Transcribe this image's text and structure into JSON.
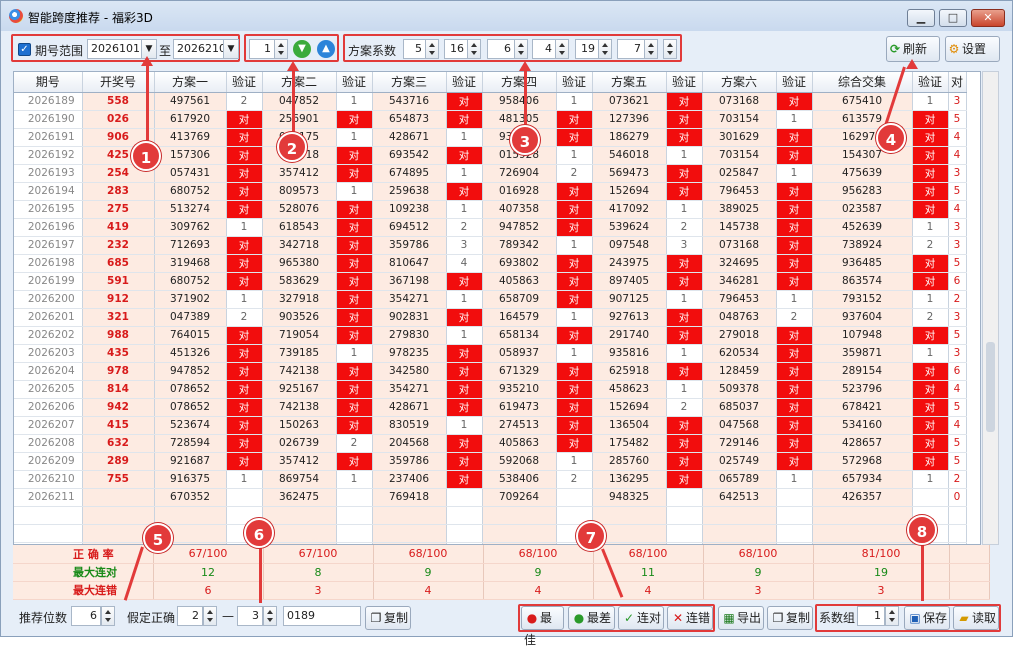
{
  "window": {
    "title": "智能跨度推荐 - 福彩3D",
    "min_label": "▁",
    "max_label": "□",
    "close_label": "✕"
  },
  "toolbar": {
    "period_range_label": "期号范围",
    "period_from": "2026101",
    "period_to": "2026210",
    "to_label": "至",
    "step_value": "1",
    "scheme_coef_label": "方案系数",
    "coef_values": [
      "5",
      "16",
      "6",
      "4",
      "19",
      "7"
    ],
    "refresh_label": "刷新",
    "settings_label": "设置"
  },
  "grid": {
    "headers": [
      "期号",
      "开奖号",
      "方案一",
      "验证",
      "方案二",
      "验证",
      "方案三",
      "验证",
      "方案四",
      "验证",
      "方案五",
      "验证",
      "方案六",
      "验证",
      "综合交集",
      "验证",
      "对"
    ],
    "rows": [
      [
        "2026189",
        "558",
        "497561",
        "2",
        "047852",
        "1",
        "543716",
        "对",
        "958406",
        "1",
        "073621",
        "对",
        "073168",
        "对",
        "675410",
        "1",
        "3"
      ],
      [
        "2026190",
        "026",
        "617920",
        "对",
        "256901",
        "对",
        "654873",
        "对",
        "481305",
        "对",
        "127396",
        "对",
        "703154",
        "1",
        "613579",
        "对",
        "5"
      ],
      [
        "2026191",
        "906",
        "413769",
        "对",
        "086175",
        "1",
        "428671",
        "1",
        "935016",
        "对",
        "186279",
        "对",
        "301629",
        "对",
        "162978",
        "对",
        "4"
      ],
      [
        "2026192",
        "425",
        "157306",
        "对",
        "023718",
        "对",
        "693542",
        "对",
        "015928",
        "1",
        "546018",
        "1",
        "703154",
        "对",
        "154307",
        "对",
        "4"
      ],
      [
        "2026193",
        "254",
        "057431",
        "对",
        "357412",
        "对",
        "674895",
        "1",
        "726904",
        "2",
        "569473",
        "对",
        "025847",
        "1",
        "475639",
        "对",
        "3"
      ],
      [
        "2026194",
        "283",
        "680752",
        "对",
        "809573",
        "1",
        "259638",
        "对",
        "016928",
        "对",
        "152694",
        "对",
        "796453",
        "对",
        "956283",
        "对",
        "5"
      ],
      [
        "2026195",
        "275",
        "513274",
        "对",
        "528076",
        "对",
        "109238",
        "1",
        "407358",
        "对",
        "417092",
        "1",
        "389025",
        "对",
        "023587",
        "对",
        "4"
      ],
      [
        "2026196",
        "419",
        "309762",
        "1",
        "618543",
        "对",
        "694512",
        "2",
        "947852",
        "对",
        "539624",
        "2",
        "145738",
        "对",
        "452639",
        "1",
        "3"
      ],
      [
        "2026197",
        "232",
        "712693",
        "对",
        "342718",
        "对",
        "359786",
        "3",
        "789342",
        "1",
        "097548",
        "3",
        "073168",
        "对",
        "738924",
        "2",
        "3"
      ],
      [
        "2026198",
        "685",
        "319468",
        "对",
        "965380",
        "对",
        "810647",
        "4",
        "693802",
        "对",
        "243975",
        "对",
        "324695",
        "对",
        "936485",
        "对",
        "5"
      ],
      [
        "2026199",
        "591",
        "680752",
        "对",
        "583629",
        "对",
        "367198",
        "对",
        "405863",
        "对",
        "897405",
        "对",
        "346281",
        "对",
        "863574",
        "对",
        "6"
      ],
      [
        "2026200",
        "912",
        "371902",
        "1",
        "327918",
        "对",
        "354271",
        "1",
        "658709",
        "对",
        "907125",
        "1",
        "796453",
        "1",
        "793152",
        "1",
        "2"
      ],
      [
        "2026201",
        "321",
        "047389",
        "2",
        "903526",
        "对",
        "902831",
        "对",
        "164579",
        "1",
        "927613",
        "对",
        "048763",
        "2",
        "937604",
        "2",
        "3"
      ],
      [
        "2026202",
        "988",
        "764015",
        "对",
        "719054",
        "对",
        "279830",
        "1",
        "658134",
        "对",
        "291740",
        "对",
        "279018",
        "对",
        "107948",
        "对",
        "5"
      ],
      [
        "2026203",
        "435",
        "451326",
        "对",
        "739185",
        "1",
        "978235",
        "对",
        "058937",
        "1",
        "935816",
        "1",
        "620534",
        "对",
        "359871",
        "1",
        "3"
      ],
      [
        "2026204",
        "978",
        "947852",
        "对",
        "742138",
        "对",
        "342580",
        "对",
        "671329",
        "对",
        "625918",
        "对",
        "128459",
        "对",
        "289154",
        "对",
        "6"
      ],
      [
        "2026205",
        "814",
        "078652",
        "对",
        "925167",
        "对",
        "354271",
        "对",
        "935210",
        "对",
        "458623",
        "1",
        "509378",
        "对",
        "523796",
        "对",
        "4"
      ],
      [
        "2026206",
        "942",
        "078652",
        "对",
        "742138",
        "对",
        "428671",
        "对",
        "619473",
        "对",
        "152694",
        "2",
        "685037",
        "对",
        "678421",
        "对",
        "5"
      ],
      [
        "2026207",
        "415",
        "523674",
        "对",
        "150263",
        "对",
        "830519",
        "1",
        "274513",
        "对",
        "136504",
        "对",
        "047568",
        "对",
        "534160",
        "对",
        "4"
      ],
      [
        "2026208",
        "632",
        "728594",
        "对",
        "026739",
        "2",
        "204568",
        "对",
        "405863",
        "对",
        "175482",
        "对",
        "729146",
        "对",
        "428657",
        "对",
        "5"
      ],
      [
        "2026209",
        "289",
        "921687",
        "对",
        "357412",
        "对",
        "359786",
        "对",
        "592068",
        "1",
        "285760",
        "对",
        "025749",
        "对",
        "572968",
        "对",
        "5"
      ],
      [
        "2026210",
        "755",
        "916375",
        "1",
        "869754",
        "1",
        "237406",
        "对",
        "538406",
        "2",
        "136295",
        "对",
        "065789",
        "1",
        "657934",
        "1",
        "2"
      ],
      [
        "2026211",
        "",
        "670352",
        "",
        "362475",
        "",
        "769418",
        "",
        "709264",
        "",
        "948325",
        "",
        "642513",
        "",
        "426357",
        "",
        "0"
      ]
    ]
  },
  "stats": {
    "accuracy_label": "正 确 率",
    "accuracy": [
      "67/100",
      "67/100",
      "68/100",
      "68/100",
      "68/100",
      "68/100",
      "81/100"
    ],
    "max_hit_streak_label": "最大连对",
    "max_hit_streak": [
      "12",
      "8",
      "9",
      "9",
      "11",
      "9",
      "19"
    ],
    "max_miss_streak_label": "最大连错",
    "max_miss_streak": [
      "6",
      "3",
      "4",
      "4",
      "4",
      "3",
      "3"
    ]
  },
  "bottom": {
    "recommend_digits_label": "推荐位数",
    "recommend_digits_value": "6",
    "assume_correct_label": "假定正确",
    "assume_from": "2",
    "dash": "—",
    "assume_to": "3",
    "code_value": "0189",
    "copy_label": "复制",
    "best_label": "最佳",
    "worst_label": "最差",
    "streak_hit_label": "连对",
    "streak_miss_label": "连错",
    "export_label": "导出",
    "copy2_label": "复制",
    "coef_group_label": "系数组",
    "coef_group_value": "1",
    "save_label": "保存",
    "load_label": "读取"
  },
  "annotations": [
    "1",
    "2",
    "3",
    "4",
    "5",
    "6",
    "7",
    "8"
  ],
  "colors": {
    "hit_red": "#f20d0d",
    "row_peach": "#fdebe2",
    "annotation_red": "#e23a3a",
    "win_bg": "#e6eef8"
  }
}
